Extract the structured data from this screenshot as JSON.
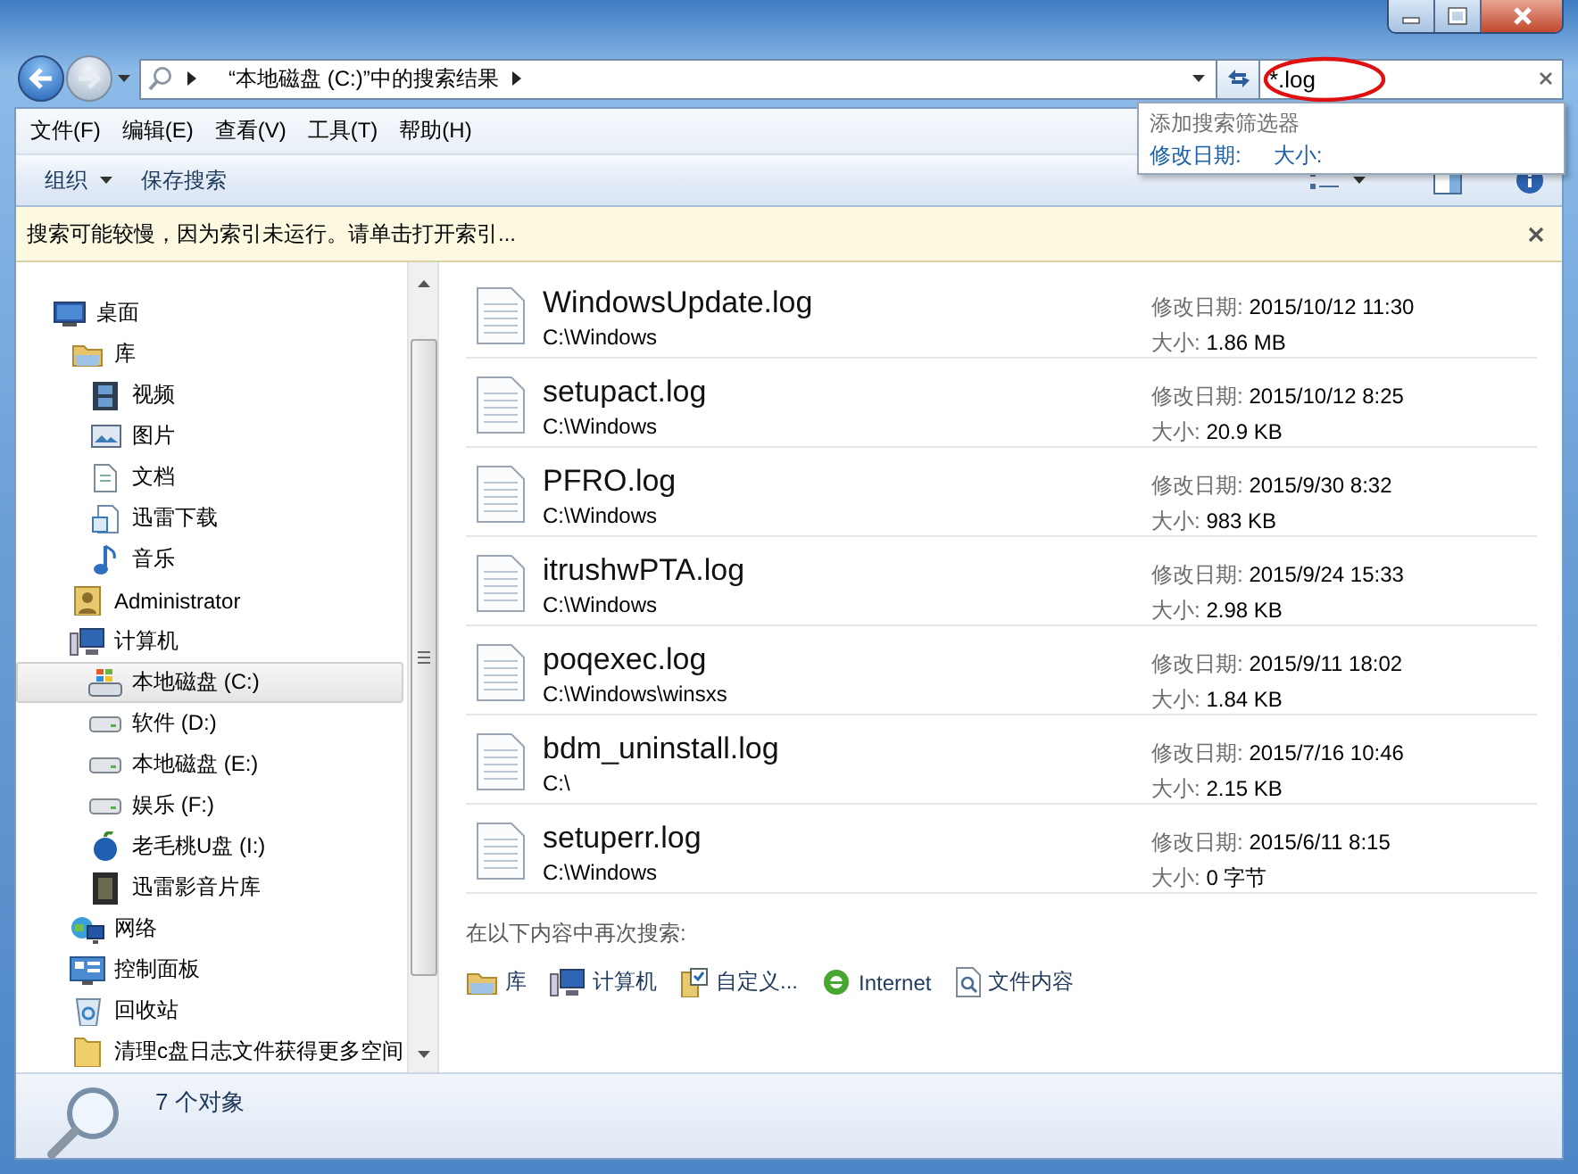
{
  "navigation": {
    "back_enabled": true,
    "forward_enabled": false
  },
  "address_bar": {
    "path": "“本地磁盘 (C:)”中的搜索结果"
  },
  "search": {
    "value": "*.log",
    "highlighted": true
  },
  "filter_popup": {
    "title": "添加搜索筛选器",
    "filters": [
      "修改日期:",
      "大小:"
    ]
  },
  "menu_bar": [
    "文件(F)",
    "编辑(E)",
    "查看(V)",
    "工具(T)",
    "帮助(H)"
  ],
  "toolbar": [
    {
      "label": "组织",
      "kind": "dropdown"
    },
    {
      "label": "保存搜索",
      "kind": "button"
    }
  ],
  "info_bar": {
    "message": "搜索可能较慢，因为索引未运行。请单击打开索引..."
  },
  "sidebar": {
    "items": [
      {
        "label": "桌面",
        "kind": "desktop",
        "selected": false,
        "children": [
          {
            "label": "库",
            "kind": "library",
            "selected": false,
            "children": [
              {
                "label": "视频",
                "kind": "video",
                "selected": false
              },
              {
                "label": "图片",
                "kind": "picture",
                "selected": false
              },
              {
                "label": "文档",
                "kind": "document",
                "selected": false
              },
              {
                "label": "迅雷下载",
                "kind": "download",
                "selected": false
              },
              {
                "label": "音乐",
                "kind": "music",
                "selected": false
              }
            ]
          },
          {
            "label": "Administrator",
            "kind": "user",
            "selected": false
          },
          {
            "label": "计算机",
            "kind": "computer",
            "selected": false,
            "children": [
              {
                "label": "本地磁盘 (C:)",
                "kind": "system-drive",
                "selected": true
              },
              {
                "label": "软件 (D:)",
                "kind": "drive",
                "selected": false
              },
              {
                "label": "本地磁盘 (E:)",
                "kind": "drive",
                "selected": false
              },
              {
                "label": "娱乐 (F:)",
                "kind": "drive",
                "selected": false
              },
              {
                "label": "老毛桃U盘 (I:)",
                "kind": "usb",
                "selected": false
              },
              {
                "label": "迅雷影音片库",
                "kind": "media",
                "selected": false
              }
            ]
          },
          {
            "label": "网络",
            "kind": "network",
            "selected": false
          },
          {
            "label": "控制面板",
            "kind": "control-panel",
            "selected": false
          },
          {
            "label": "回收站",
            "kind": "recycle",
            "selected": false
          },
          {
            "label": "清理c盘日志文件获得更多空间",
            "kind": "folder",
            "selected": false
          }
        ]
      }
    ]
  },
  "results": [
    {
      "name": "WindowsUpdate.log",
      "location": "C:\\Windows",
      "date_label": "修改日期:",
      "date": "2015/10/12 11:30",
      "size_label": "大小:",
      "size": "1.86 MB"
    },
    {
      "name": "setupact.log",
      "location": "C:\\Windows",
      "date_label": "修改日期:",
      "date": "2015/10/12 8:25",
      "size_label": "大小:",
      "size": "20.9 KB"
    },
    {
      "name": "PFRO.log",
      "location": "C:\\Windows",
      "date_label": "修改日期:",
      "date": "2015/9/30 8:32",
      "size_label": "大小:",
      "size": "983 KB"
    },
    {
      "name": "itrushwPTA.log",
      "location": "C:\\Windows",
      "date_label": "修改日期:",
      "date": "2015/9/24 15:33",
      "size_label": "大小:",
      "size": "2.98 KB"
    },
    {
      "name": "poqexec.log",
      "location": "C:\\Windows\\winsxs",
      "date_label": "修改日期:",
      "date": "2015/9/11 18:02",
      "size_label": "大小:",
      "size": "1.84 KB"
    },
    {
      "name": "bdm_uninstall.log",
      "location": "C:\\",
      "date_label": "修改日期:",
      "date": "2015/7/16 10:46",
      "size_label": "大小:",
      "size": "2.15 KB"
    },
    {
      "name": "setuperr.log",
      "location": "C:\\Windows",
      "date_label": "修改日期:",
      "date": "2015/6/11 8:15",
      "size_label": "大小:",
      "size": "0 字节"
    }
  ],
  "search_again": {
    "label": "在以下内容中再次搜索:",
    "locations": [
      {
        "label": "库",
        "kind": "library"
      },
      {
        "label": "计算机",
        "kind": "computer"
      },
      {
        "label": "自定义...",
        "kind": "custom"
      },
      {
        "label": "Internet",
        "kind": "internet"
      },
      {
        "label": "文件内容",
        "kind": "file-contents"
      }
    ]
  },
  "status_bar": {
    "count": "7 个对象"
  }
}
